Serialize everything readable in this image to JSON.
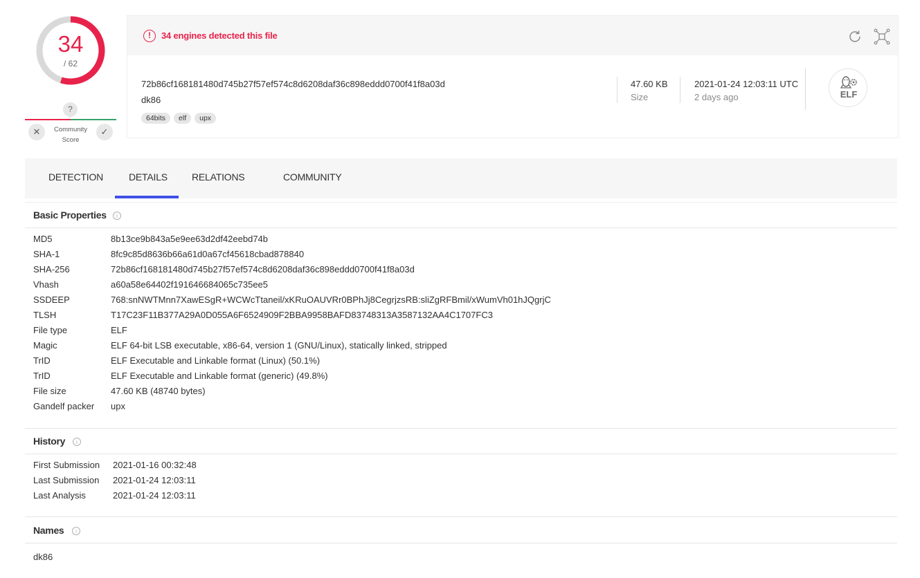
{
  "score": {
    "detections": "34",
    "total": "/ 62",
    "colors": {
      "malicious": "#e8234b",
      "benign_ring": "#d9d9d9"
    }
  },
  "community": {
    "unknown_glyph": "?",
    "label_line1": "Community",
    "label_line2": "Score",
    "negative_glyph": "✕",
    "positive_glyph": "✓"
  },
  "file": {
    "alert_glyph": "!",
    "alert_text": "34 engines detected this file",
    "sha256": "72b86cf168181480d745b27f57ef574c8d6208daf36c898eddd0700f41f8a03d",
    "name": "dk86",
    "tags": [
      "64bits",
      "elf",
      "upx"
    ],
    "size": "47.60 KB",
    "size_label": "Size",
    "date": "2021-01-24 12:03:11 UTC",
    "date_relative": "2 days ago",
    "type_badge": "ELF",
    "icons": {
      "refresh": "refresh-icon",
      "graph": "graph-summary-icon",
      "type": "linux-elf-icon"
    }
  },
  "tabs": [
    "DETECTION",
    "DETAILS",
    "RELATIONS",
    "COMMUNITY"
  ],
  "active_tab": "DETAILS",
  "info_glyph": "i",
  "basic_properties": {
    "title": "Basic Properties",
    "rows": [
      {
        "key": "MD5",
        "value": "8b13ce9b843a5e9ee63d2df42eebd74b"
      },
      {
        "key": "SHA-1",
        "value": "8fc9c85d8636b66a61d0a67cf45618cbad878840"
      },
      {
        "key": "SHA-256",
        "value": "72b86cf168181480d745b27f57ef574c8d6208daf36c898eddd0700f41f8a03d"
      },
      {
        "key": "Vhash",
        "value": "a60a58e64402f191646684065c735ee5"
      },
      {
        "key": "SSDEEP",
        "value": "768:snNWTMnn7XawESgR+WCWcTtaneil/xKRuOAUVRr0BPhJj8CegrjzsRB:sliZgRFBmil/xWumVh01hJQgrjC"
      },
      {
        "key": "TLSH",
        "value": "T17C23F11B377A29A0D055A6F6524909F2BBA9958BAFD83748313A3587132AA4C1707FC3"
      },
      {
        "key": "File type",
        "value": "ELF"
      },
      {
        "key": "Magic",
        "value": "ELF 64-bit LSB executable, x86-64, version 1 (GNU/Linux), statically linked, stripped"
      },
      {
        "key": "TrID",
        "value": "ELF Executable and Linkable format (Linux) (50.1%)"
      },
      {
        "key": "TrID",
        "value": "ELF Executable and Linkable format (generic) (49.8%)"
      },
      {
        "key": "File size",
        "value": "47.60 KB (48740 bytes)"
      },
      {
        "key": "Gandelf packer",
        "value": "upx"
      }
    ]
  },
  "history": {
    "title": "History",
    "rows": [
      {
        "key": "First Submission",
        "value": "2021-01-16 00:32:48"
      },
      {
        "key": "Last Submission",
        "value": "2021-01-24 12:03:11"
      },
      {
        "key": "Last Analysis",
        "value": "2021-01-24 12:03:11"
      }
    ]
  },
  "names": {
    "title": "Names",
    "items": [
      "dk86"
    ]
  }
}
